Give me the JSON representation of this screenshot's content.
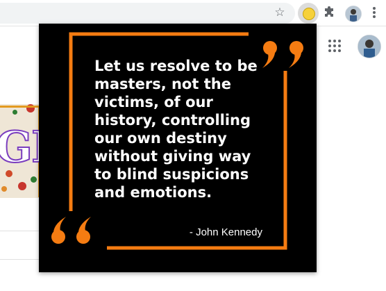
{
  "browser": {
    "icons": [
      "star-icon",
      "extension-icon",
      "puzzle-icon",
      "profile-avatar",
      "kebab-menu-icon"
    ]
  },
  "page": {
    "icons": [
      "apps-grid-icon",
      "profile-avatar"
    ],
    "doodle_fragment": "GL"
  },
  "popup": {
    "quote": "Let us resolve to be masters, not the victims, of our history, controlling our own destiny without giving way to blind suspicions and emotions.",
    "author": "- John Kennedy",
    "colors": {
      "background": "#000000",
      "accent": "#f57c12",
      "text": "#ffffff"
    }
  }
}
